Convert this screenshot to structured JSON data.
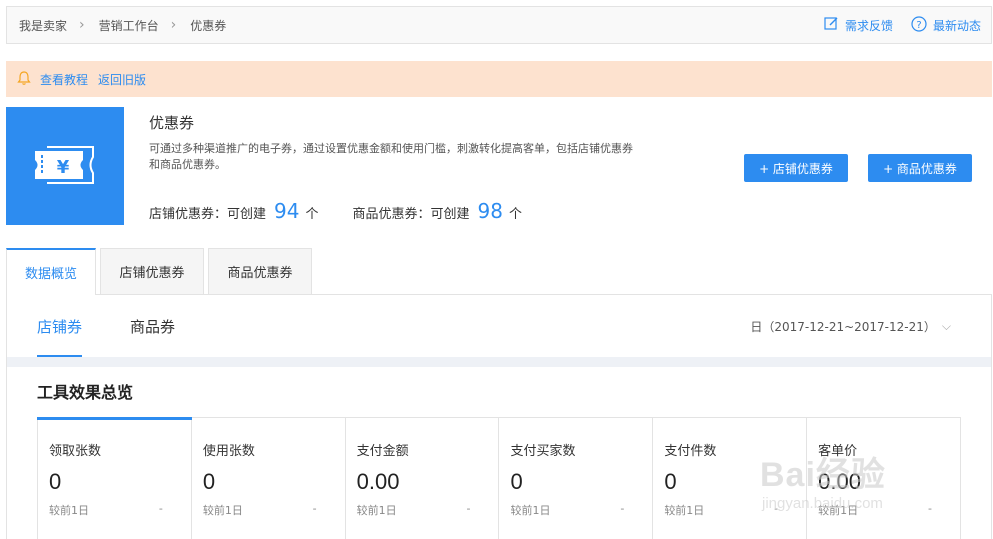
{
  "breadcrumb": [
    "我是卖家",
    "营销工作台",
    "优惠券"
  ],
  "top_actions": {
    "feedback": "需求反馈",
    "news": "最新动态"
  },
  "notice": {
    "tutorial": "查看教程",
    "old_version": "返回旧版"
  },
  "coupon": {
    "title": "优惠券",
    "description": "可通过多种渠道推广的电子券，通过设置优惠金额和使用门槛，刺激转化提高客单，包括店铺优惠券和商品优惠券。",
    "shop_label": "店铺优惠券：可创建",
    "shop_count": "94",
    "goods_label": "商品优惠券：可创建",
    "goods_count": "98",
    "unit": "个",
    "add_shop_button": "+ 店铺优惠券",
    "add_goods_button": "+ 商品优惠券"
  },
  "tabs": [
    "数据概览",
    "店铺优惠券",
    "商品优惠券"
  ],
  "subtabs": [
    "店铺券",
    "商品券"
  ],
  "date_range": "日（2017-12-21~2017-12-21）",
  "section_title": "工具效果总览",
  "metrics": [
    {
      "label": "领取张数",
      "value": "0",
      "compare": "较前1日",
      "change": "-"
    },
    {
      "label": "使用张数",
      "value": "0",
      "compare": "较前1日",
      "change": "-"
    },
    {
      "label": "支付金额",
      "value": "0.00",
      "compare": "较前1日",
      "change": "-"
    },
    {
      "label": "支付买家数",
      "value": "0",
      "compare": "较前1日",
      "change": "-"
    },
    {
      "label": "支付件数",
      "value": "0",
      "compare": "较前1日",
      "change": "-"
    },
    {
      "label": "客单价",
      "value": "0.00",
      "compare": "较前1日",
      "change": "-"
    }
  ],
  "watermark": {
    "main": "Bai经验",
    "sub": "jingyan.baidu.com"
  },
  "colors": {
    "accent": "#2d8cf0",
    "notice_bg": "#fde2cf"
  },
  "icons": {
    "feedback": "edit-icon",
    "news": "help-circle-icon",
    "notice": "bell-icon",
    "hero": "coupon-yen-icon"
  }
}
